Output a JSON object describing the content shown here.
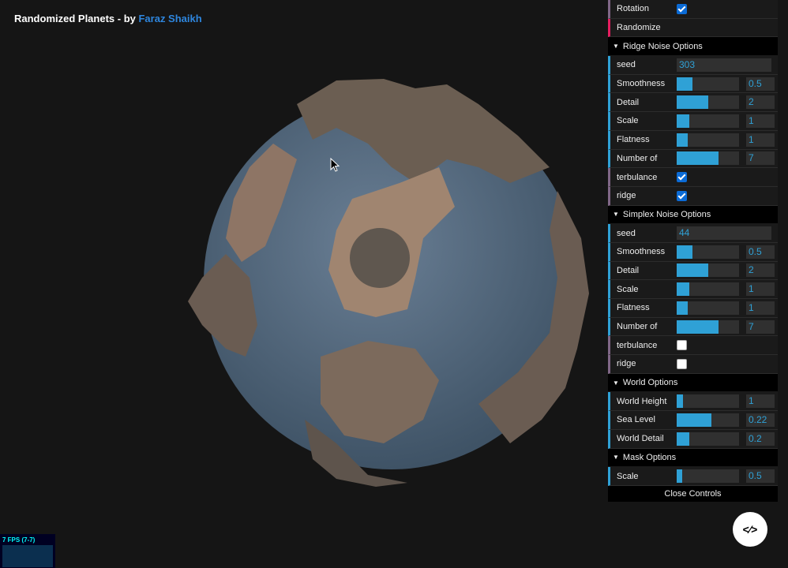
{
  "title": {
    "prefix": "Randomized Planets - by ",
    "author": "Faraz Shaikh"
  },
  "gui": {
    "top": [
      {
        "type": "bool",
        "label": "Rotation",
        "checked": true
      },
      {
        "type": "func",
        "label": "Randomize"
      }
    ],
    "folders": [
      {
        "title": "Ridge Noise Options",
        "rows": [
          {
            "type": "text",
            "label": "seed",
            "value": "303"
          },
          {
            "type": "num",
            "label": "Smoothness",
            "value": "0.5",
            "fill": 0.25
          },
          {
            "type": "num",
            "label": "Detail",
            "value": "2",
            "fill": 0.5
          },
          {
            "type": "num",
            "label": "Scale",
            "value": "1",
            "fill": 0.2
          },
          {
            "type": "num",
            "label": "Flatness",
            "value": "1",
            "fill": 0.18
          },
          {
            "type": "num",
            "label": "Number of",
            "value": "7",
            "fill": 0.67
          },
          {
            "type": "bool",
            "label": "terbulance",
            "checked": true
          },
          {
            "type": "bool",
            "label": "ridge",
            "checked": true
          }
        ]
      },
      {
        "title": "Simplex Noise Options",
        "rows": [
          {
            "type": "text",
            "label": "seed",
            "value": "44"
          },
          {
            "type": "num",
            "label": "Smoothness",
            "value": "0.5",
            "fill": 0.25
          },
          {
            "type": "num",
            "label": "Detail",
            "value": "2",
            "fill": 0.5
          },
          {
            "type": "num",
            "label": "Scale",
            "value": "1",
            "fill": 0.2
          },
          {
            "type": "num",
            "label": "Flatness",
            "value": "1",
            "fill": 0.18
          },
          {
            "type": "num",
            "label": "Number of",
            "value": "7",
            "fill": 0.67
          },
          {
            "type": "bool",
            "label": "terbulance",
            "checked": false
          },
          {
            "type": "bool",
            "label": "ridge",
            "checked": false
          }
        ]
      },
      {
        "title": "World Options",
        "rows": [
          {
            "type": "num",
            "label": "World Height",
            "value": "1",
            "fill": 0.1
          },
          {
            "type": "num",
            "label": "Sea Level",
            "value": "0.22",
            "fill": 0.56
          },
          {
            "type": "num",
            "label": "World Detail",
            "value": "0.2",
            "fill": 0.2
          }
        ]
      },
      {
        "title": "Mask Options",
        "rows": [
          {
            "type": "num",
            "label": "Scale",
            "value": "0.5",
            "fill": 0.09
          }
        ]
      }
    ],
    "close_label": "Close Controls"
  },
  "fps": {
    "label": "7 FPS (7-7)"
  },
  "code_button": {
    "label": "<⁄>"
  }
}
